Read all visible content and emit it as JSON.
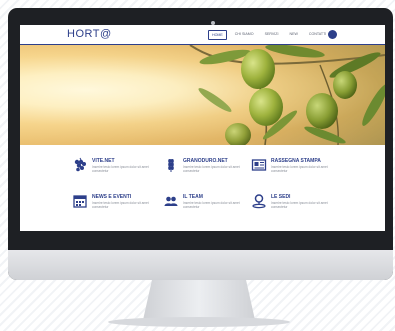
{
  "site": {
    "logo": "HORT@",
    "accent_color": "#2d3f8a",
    "nav": [
      {
        "label": "HOME",
        "active": true
      },
      {
        "label": "CHI SIAMO",
        "active": false
      },
      {
        "label": "SERVIZI",
        "active": false
      },
      {
        "label": "NEW",
        "active": false
      },
      {
        "label": "CONTATTI",
        "active": false
      }
    ],
    "nav_button_icon": "circle-button-icon"
  },
  "hero": {
    "image": "olives-on-branch"
  },
  "services": [
    {
      "title": "VITE.NET",
      "icon": "grape-icon",
      "desc": "Inserire testo lorem ipsum dolor sit amet consectetur"
    },
    {
      "title": "GRANODURO.NET",
      "icon": "wheat-icon",
      "desc": "Inserire testo lorem ipsum dolor sit amet consectetur"
    },
    {
      "title": "RASSEGNA STAMPA",
      "icon": "newspaper-icon",
      "desc": "Inserire testo lorem ipsum dolor sit amet consectetur"
    },
    {
      "title": "NEWS E EVENTI",
      "icon": "calendar-icon",
      "desc": "Inserire testo lorem ipsum dolor sit amet consectetur"
    },
    {
      "title": "IL TEAM",
      "icon": "team-icon",
      "desc": "Inserire testo lorem ipsum dolor sit amet consectetur"
    },
    {
      "title": "LE SEDI",
      "icon": "location-icon",
      "desc": "Inserire testo lorem ipsum dolor sit amet consectetur"
    }
  ]
}
